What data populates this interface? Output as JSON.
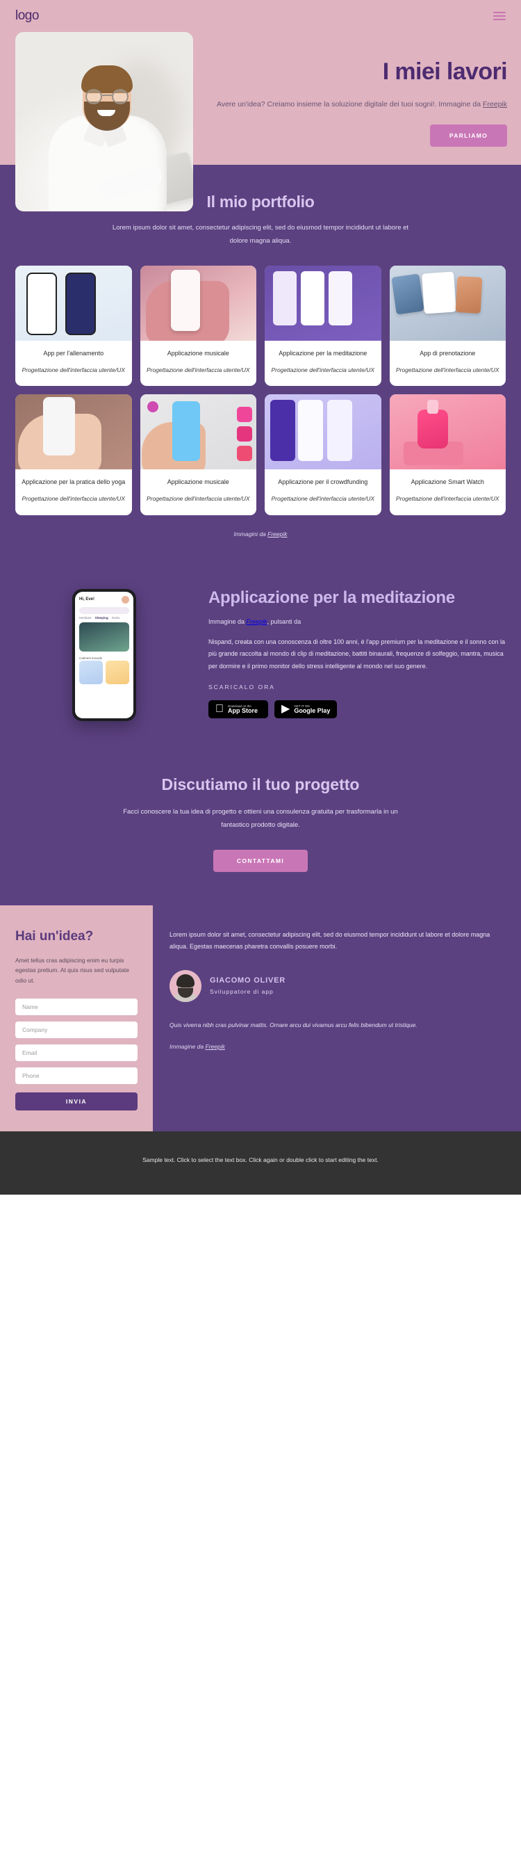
{
  "nav": {
    "logo": "logo",
    "menu_icon": "hamburger-menu-icon"
  },
  "hero": {
    "title": "I miei lavori",
    "subtitle": "Avere un'idea? Creiamo insieme la soluzione digitale dei tuoi sogni!. Immagine da ",
    "subtitle_link": "Freepik",
    "cta": "PARLIAMO"
  },
  "portfolio": {
    "title": "Il mio portfolio",
    "subtitle": "Lorem ipsum dolor sit amet, consectetur adipiscing elit, sed do eiusmod tempor incididunt ut labore et dolore magna aliqua.",
    "credit_prefix": "Immagini da ",
    "credit_link": "Freepik",
    "meta": "Progettazione dell'interfaccia utente/UX",
    "cards": [
      {
        "title": "App per l'allenamento",
        "meta": "Progettazione dell'interfaccia utente/UX"
      },
      {
        "title": "Applicazione musicale",
        "meta": "Progettazione dell'interfaccia utente/UX"
      },
      {
        "title": "Applicazione per la meditazione",
        "meta": "Progettazione dell'interfaccia utente/UX"
      },
      {
        "title": "App di prenotazione",
        "meta": "Progettazione dell'interfaccia utente/UX"
      },
      {
        "title": "Applicazione per la pratica dello yoga",
        "meta": "Progettazione dell'interfaccia utente/UX"
      },
      {
        "title": "Applicazione musicale",
        "meta": "Progettazione dell'interfaccia utente/UX"
      },
      {
        "title": "Applicazione per il crowdfunding",
        "meta": "Progettazione dell'interfaccia utente/UX"
      },
      {
        "title": "Applicazione Smart Watch",
        "meta": "Progettazione dell'interfaccia utente/UX"
      }
    ]
  },
  "meditation": {
    "title": "Applicazione per la meditazione",
    "credit_prefix": "Immagine da ",
    "credit_link": "Freepik",
    "credit_suffix": ", pulsanti da",
    "body": "Nispand, creata con una conoscenza di oltre 100 anni, è l'app premium per la meditazione e il sonno con la più grande raccolta al mondo di clip di meditazione, battiti binaurali, frequenze di solfeggio, mantra, musica per dormire e il primo monitor dello stress intelligente al mondo nel suo genere.",
    "download_label": "SCARICALO ORA",
    "stores": [
      {
        "small": "Download on the",
        "big": "App Store",
        "icon": "apple-icon"
      },
      {
        "small": "GET IT ON",
        "big": "Google Play",
        "icon": "google-play-icon"
      }
    ],
    "phone": {
      "greeting": "Hi, Eve!",
      "tabs": [
        "Meditate",
        "Sleeping",
        "Relax"
      ],
      "section_label": "Calmest sounds"
    }
  },
  "discuss": {
    "title": "Discutiamo il tuo progetto",
    "body": "Facci conoscere la tua idea di progetto e ottieni una consulenza gratuita per trasformarla in un fantastico prodotto digitale.",
    "cta": "CONTATTAMI"
  },
  "contact": {
    "title": "Hai un'idea?",
    "body": "Amet tellus cras adipiscing enim eu turpis egestas pretium. At quis risus sed vulputate odio ut.",
    "fields": [
      {
        "name": "name-field",
        "placeholder": "Name"
      },
      {
        "name": "company-field",
        "placeholder": "Company"
      },
      {
        "name": "email-field",
        "placeholder": "Email"
      },
      {
        "name": "phone-field",
        "placeholder": "Phone"
      }
    ],
    "submit": "INVIA",
    "lead": "Lorem ipsum dolor sit amet, consectetur adipiscing elit, sed do eiusmod tempor incididunt ut labore et dolore magna aliqua. Egestas maecenas pharetra convallis posuere morbi.",
    "person_name": "GIACOMO OLIVER",
    "person_role": "Sviluppatore di app",
    "quote": "Quis viverra nibh cras pulvinar mattis. Ornare arcu dui vivamus arcu felis bibendum ut tristique.",
    "image_credit_prefix": "Immagine da ",
    "image_credit_link": "Freepik"
  },
  "footer": {
    "text": "Sample text. Click to select the text box. Click again or double click to start editing the text."
  },
  "colors": {
    "pink_bg": "#dfb3c0",
    "purple_bg": "#5b4180",
    "purple_dark": "#4d2b70",
    "accent_pink": "#c976b6",
    "lilac": "#d9c6ef",
    "footer_bg": "#333333"
  }
}
